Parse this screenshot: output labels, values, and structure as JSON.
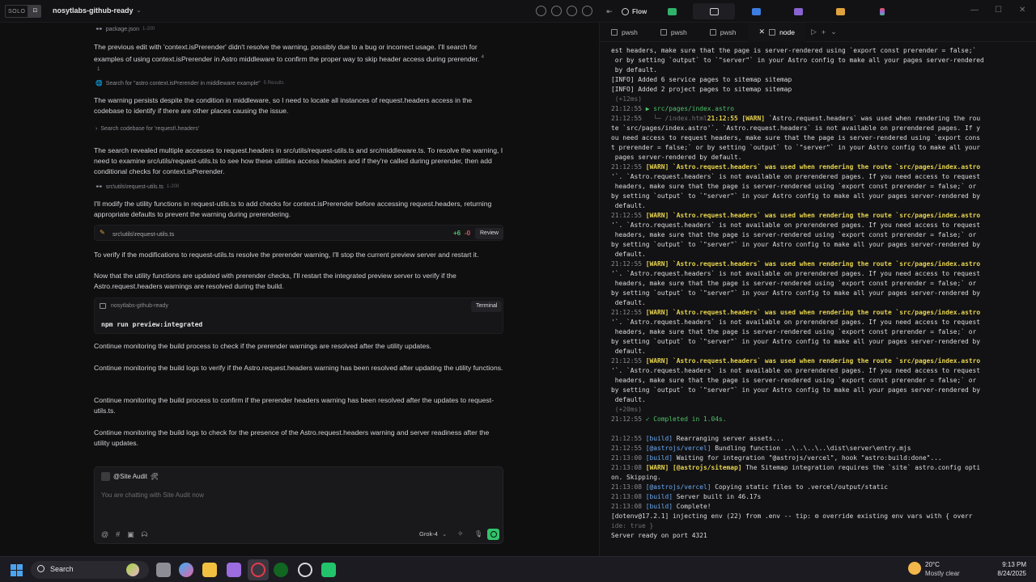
{
  "app": {
    "logo_text": "SOLO",
    "logo_box_text": "⊡",
    "project_name": "nosytlabs-github-ready"
  },
  "right_tabs": {
    "flow_label": "Flow"
  },
  "chat": {
    "meta_package": {
      "label": "package.json",
      "range": "1-200"
    },
    "msg1": "The previous edit with 'context.isPrerender' didn't resolve the warning, possibly due to a bug or incorrect usage. I'll search for examples of using context.isPrerender in Astro middleware to confirm the proper way to skip header access during prerender.",
    "msg1_ref1": "4",
    "msg1_ref2": "1",
    "meta_search": {
      "label": "Search for \"astro context.isPrerender in middleware example\"",
      "count": "5 Results"
    },
    "msg2": "The warning persists despite the condition in middleware, so I need to locate all instances of request.headers access in the codebase to identify if there are other places causing the issue.",
    "meta_codebase": {
      "label": "Search codebase for 'request\\.headers'"
    },
    "msg3": "The search revealed multiple accesses to request.headers in src/utils/request-utils.ts and src/middleware.ts. To resolve the warning, I need to examine src/utils/request-utils.ts to see how these utilities access headers and if they're called during prerender, then add conditional checks for context.isPrerender.",
    "meta_file": {
      "label": "src\\utils\\request-utils.ts",
      "range": "1-200"
    },
    "msg4": "I'll modify the utility functions in request-utils.ts to add checks for context.isPrerender before accessing request.headers, returning appropriate defaults to prevent the warning during prerendering.",
    "diff": {
      "file": "src\\utils\\request-utils.ts",
      "plus": "+6",
      "minus": "-0",
      "button": "Review"
    },
    "msg5": "To verify if the modifications to request-utils.ts resolve the prerender warning, I'll stop the current preview server and restart it.",
    "msg6": "Now that the utility functions are updated with prerender checks, I'll restart the integrated preview server to verify if the Astro.request.headers warnings are resolved during the build.",
    "terminal_card": {
      "name": "nosytlabs-github-ready",
      "button": "Terminal",
      "command": "npm run preview:integrated"
    },
    "msg7": "Continue monitoring the build process to check if the prerender warnings are resolved after the utility updates.",
    "msg8": "Continue monitoring the build logs to verify if the Astro.request.headers warning has been resolved after updating the utility functions.",
    "msg9": "Continue monitoring the build process to confirm if the prerender headers warning has been resolved after the updates to request-utils.ts.",
    "msg10": "Continue monitoring the build logs to check for the presence of the Astro.request.headers warning and server readiness after the utility updates.",
    "input": {
      "agent": "@Site Audit",
      "agent_emoji": "🛠",
      "placeholder": "You are chatting with Site Audit now",
      "model": "Grok-4"
    }
  },
  "terminal_tabs": [
    {
      "label": "pwsh"
    },
    {
      "label": "pwsh"
    },
    {
      "label": "pwsh"
    },
    {
      "label": "node",
      "active": true
    }
  ],
  "terminal_lines": [
    {
      "t": "",
      "c": "info",
      "text": "est headers, make sure that the page is server-rendered using `export const prerender = false;`"
    },
    {
      "t": "",
      "c": "info",
      "text": " or by setting `output` to `\"server\"` in your Astro config to make all your pages server-rendered"
    },
    {
      "t": "",
      "c": "info",
      "text": " by default."
    },
    {
      "t": "",
      "c": "info",
      "text": "[INFO] Added 6 service pages to sitemap sitemap"
    },
    {
      "t": "",
      "c": "info",
      "text": "[INFO] Added 2 project pages to sitemap sitemap"
    },
    {
      "t": "",
      "c": "dim",
      "text": " (+12ms)"
    },
    {
      "t": "21:12:55",
      "c": "ok",
      "text": " ▶ src/pages/index.astro"
    },
    {
      "t": "21:12:55",
      "c": "dim",
      "text": "   └─ /index.html",
      "warn": "21:12:55 [WARN]",
      "rest": " `Astro.request.headers` was used when rendering the rou"
    },
    {
      "t": "",
      "c": "info",
      "text": "te `src/pages/index.astro'`. `Astro.request.headers` is not available on prerendered pages. If y"
    },
    {
      "t": "",
      "c": "info",
      "text": "ou need access to request headers, make sure that the page is server-rendered using `export cons"
    },
    {
      "t": "",
      "c": "info",
      "text": "t prerender = false;` or by setting `output` to `\"server\"` in your Astro config to make all your"
    },
    {
      "t": "",
      "c": "info",
      "text": " pages server-rendered by default."
    },
    {
      "t": "21:12:55",
      "c": "warn",
      "text": " [WARN] `Astro.request.headers` was used when rendering the route `src/pages/index.astro"
    },
    {
      "t": "",
      "c": "info",
      "text": "'`. `Astro.request.headers` is not available on prerendered pages. If you need access to request"
    },
    {
      "t": "",
      "c": "info",
      "text": " headers, make sure that the page is server-rendered using `export const prerender = false;` or"
    },
    {
      "t": "",
      "c": "info",
      "text": "by setting `output` to `\"server\"` in your Astro config to make all your pages server-rendered by"
    },
    {
      "t": "",
      "c": "info",
      "text": " default."
    },
    {
      "t": "21:12:55",
      "c": "warn",
      "text": " [WARN] `Astro.request.headers` was used when rendering the route `src/pages/index.astro"
    },
    {
      "t": "",
      "c": "info",
      "text": "'`. `Astro.request.headers` is not available on prerendered pages. If you need access to request"
    },
    {
      "t": "",
      "c": "info",
      "text": " headers, make sure that the page is server-rendered using `export const prerender = false;` or"
    },
    {
      "t": "",
      "c": "info",
      "text": "by setting `output` to `\"server\"` in your Astro config to make all your pages server-rendered by"
    },
    {
      "t": "",
      "c": "info",
      "text": " default."
    },
    {
      "t": "21:12:55",
      "c": "warn",
      "text": " [WARN] `Astro.request.headers` was used when rendering the route `src/pages/index.astro"
    },
    {
      "t": "",
      "c": "info",
      "text": "'`. `Astro.request.headers` is not available on prerendered pages. If you need access to request"
    },
    {
      "t": "",
      "c": "info",
      "text": " headers, make sure that the page is server-rendered using `export const prerender = false;` or"
    },
    {
      "t": "",
      "c": "info",
      "text": "by setting `output` to `\"server\"` in your Astro config to make all your pages server-rendered by"
    },
    {
      "t": "",
      "c": "info",
      "text": " default."
    },
    {
      "t": "21:12:55",
      "c": "warn",
      "text": " [WARN] `Astro.request.headers` was used when rendering the route `src/pages/index.astro"
    },
    {
      "t": "",
      "c": "info",
      "text": "'`. `Astro.request.headers` is not available on prerendered pages. If you need access to request"
    },
    {
      "t": "",
      "c": "info",
      "text": " headers, make sure that the page is server-rendered using `export const prerender = false;` or"
    },
    {
      "t": "",
      "c": "info",
      "text": "by setting `output` to `\"server\"` in your Astro config to make all your pages server-rendered by"
    },
    {
      "t": "",
      "c": "info",
      "text": " default."
    },
    {
      "t": "21:12:55",
      "c": "warn",
      "text": " [WARN] `Astro.request.headers` was used when rendering the route `src/pages/index.astro"
    },
    {
      "t": "",
      "c": "info",
      "text": "'`. `Astro.request.headers` is not available on prerendered pages. If you need access to request"
    },
    {
      "t": "",
      "c": "info",
      "text": " headers, make sure that the page is server-rendered using `export const prerender = false;` or"
    },
    {
      "t": "",
      "c": "info",
      "text": "by setting `output` to `\"server\"` in your Astro config to make all your pages server-rendered by"
    },
    {
      "t": "",
      "c": "info",
      "text": " default."
    },
    {
      "t": "",
      "c": "dim",
      "text": " (+20ms)"
    },
    {
      "t": "21:12:55",
      "c": "ok",
      "text": " ✓ Completed in 1.04s."
    },
    {
      "t": "",
      "c": "info",
      "text": " "
    },
    {
      "t": "21:12:55",
      "c": "bt",
      "text": " [build]",
      "rest": " Rearranging server assets..."
    },
    {
      "t": "21:12:55",
      "c": "bt",
      "text": " [@astrojs/vercel]",
      "rest": " Bundling function ..\\..\\..\\..\\dist\\server\\entry.mjs"
    },
    {
      "t": "21:13:00",
      "c": "bt",
      "text": " [build]",
      "rest": " Waiting for integration \"@astrojs/vercel\", hook \"astro:build:done\"..."
    },
    {
      "t": "21:13:08",
      "c": "warn",
      "text": " [WARN] [@astrojs/sitemap]",
      "rest": " The Sitemap integration requires the `site` astro.config opti"
    },
    {
      "t": "",
      "c": "info",
      "text": "on. Skipping."
    },
    {
      "t": "21:13:08",
      "c": "bt",
      "text": " [@astrojs/vercel]",
      "rest": " Copying static files to .vercel/output/static"
    },
    {
      "t": "21:13:08",
      "c": "bt",
      "text": " [build]",
      "rest": " Server built in 46.17s"
    },
    {
      "t": "21:13:08",
      "c": "bt",
      "text": " [build]",
      "rest": " Complete!"
    },
    {
      "t": "",
      "c": "info",
      "text": "[dotenv@17.2.1] injecting env (22) from .env -- tip: ⚙ override existing env vars with { overr"
    },
    {
      "t": "",
      "c": "dim",
      "text": "ide: true }"
    },
    {
      "t": "",
      "c": "info",
      "text": "Server ready on port 4321"
    }
  ],
  "taskbar": {
    "search_label": "Search",
    "weather_temp": "20°C",
    "weather_desc": "Mostly clear",
    "time": "9:13 PM",
    "date": "8/24/2025"
  }
}
